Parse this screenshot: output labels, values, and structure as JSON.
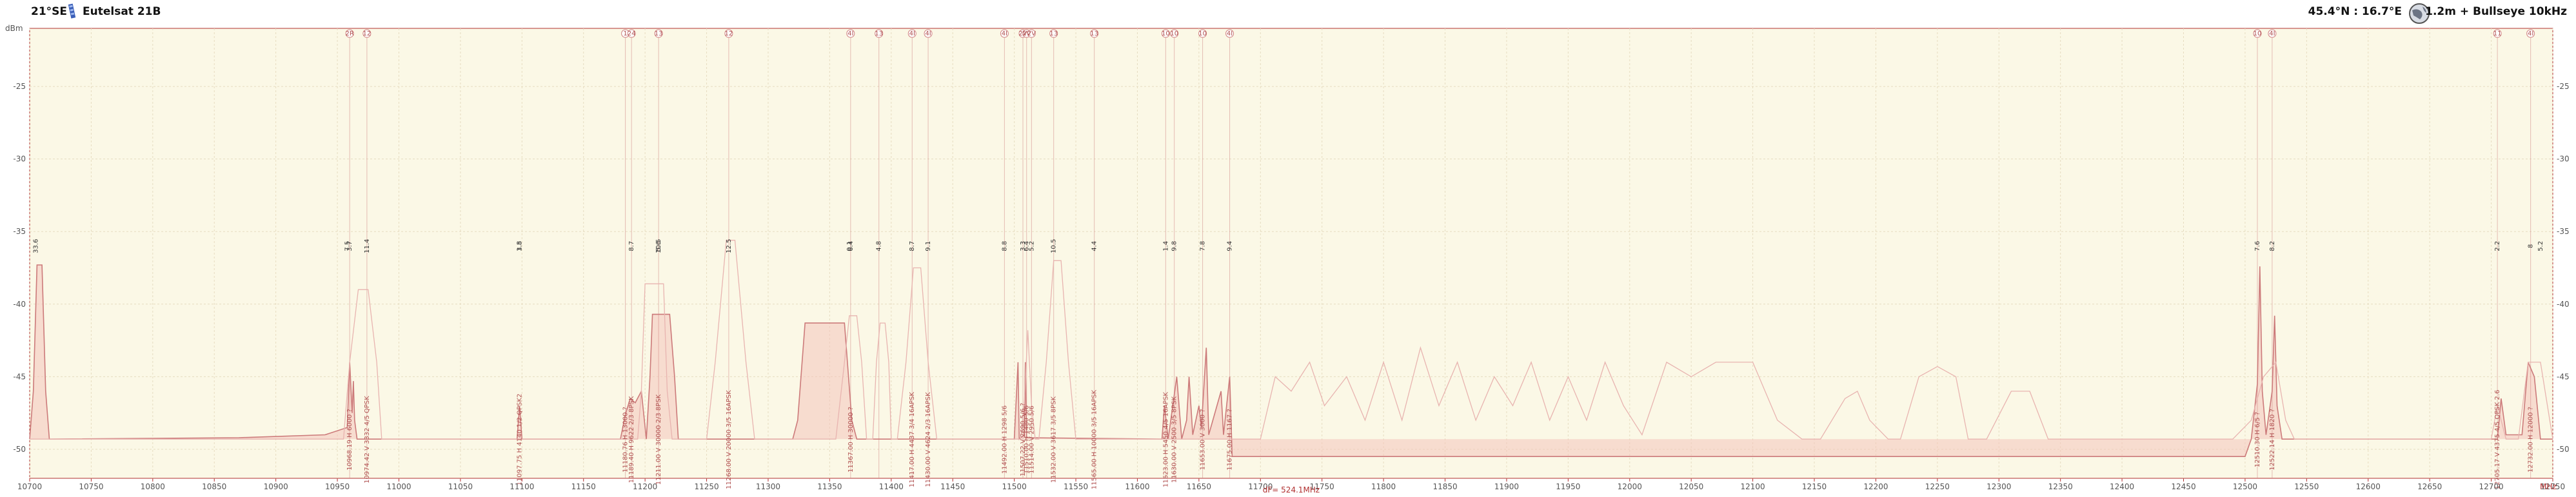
{
  "header": {
    "orbital_position": "21°SE",
    "satellite_name": "Eutelsat 21B",
    "location": "45.4°N : 16.7°E",
    "dish": "1.2m + Bullseye 10kHz"
  },
  "colors": {
    "plot_bg": "#fbf8e6",
    "grid": "#e6dcc0",
    "trace": "#cc7a7a",
    "trace_light": "#e8b4b0",
    "fill": "#f4c4bc",
    "marker": "#d08080",
    "axis": "#b03030"
  },
  "chart_data": {
    "type": "line",
    "title": "",
    "xlabel": "MHz",
    "ylabel": "dBm",
    "xlim": [
      10700,
      12750
    ],
    "ylim": [
      -52,
      -21
    ],
    "x_ticks": [
      10700,
      10750,
      10800,
      10850,
      10900,
      10950,
      11000,
      11050,
      11100,
      11150,
      11200,
      11250,
      11300,
      11350,
      11400,
      11450,
      11500,
      11550,
      11600,
      11650,
      11700,
      11750,
      11800,
      11850,
      11900,
      11950,
      12000,
      12050,
      12100,
      12150,
      12200,
      12250,
      12300,
      12350,
      12400,
      12450,
      12500,
      12550,
      12600,
      12650,
      12700,
      12750
    ],
    "y_ticks": [
      -25,
      -30,
      -35,
      -40,
      -45,
      -50
    ],
    "df_label": "dF= 524.1MHz",
    "baseline": -49.3,
    "series": [
      {
        "name": "H",
        "style": "dark",
        "points": [
          [
            10700,
            -49.3
          ],
          [
            10703,
            -46
          ],
          [
            10706,
            -37.3
          ],
          [
            10710,
            -37.3
          ],
          [
            10713,
            -46
          ],
          [
            10716,
            -49.3
          ],
          [
            10870,
            -49.2
          ],
          [
            10940,
            -49
          ],
          [
            10958,
            -48.5
          ],
          [
            10960,
            -44
          ],
          [
            10962,
            -47.5
          ],
          [
            10963,
            -45.3
          ],
          [
            10964,
            -48
          ],
          [
            10966,
            -49.3
          ],
          [
            11096,
            -49.3
          ],
          [
            11098,
            -47
          ],
          [
            11100,
            -49.3
          ],
          [
            11180,
            -49.3
          ],
          [
            11184,
            -47.6
          ],
          [
            11188,
            -46.5
          ],
          [
            11192,
            -46.8
          ],
          [
            11197,
            -46
          ],
          [
            11201,
            -49.3
          ],
          [
            11204,
            -45
          ],
          [
            11206,
            -40.7
          ],
          [
            11220,
            -40.7
          ],
          [
            11224,
            -45
          ],
          [
            11227,
            -49.3
          ],
          [
            11320,
            -49.3
          ],
          [
            11324,
            -48
          ],
          [
            11330,
            -41.3
          ],
          [
            11362,
            -41.3
          ],
          [
            11368,
            -48
          ],
          [
            11372,
            -49.3
          ],
          [
            11500,
            -49.3
          ],
          [
            11503,
            -44
          ],
          [
            11504,
            -49.3
          ],
          [
            11508,
            -49
          ],
          [
            11509,
            -44
          ],
          [
            11510,
            -49.2
          ],
          [
            11620,
            -49.3
          ],
          [
            11622,
            -47
          ],
          [
            11625,
            -49.3
          ],
          [
            11632,
            -45
          ],
          [
            11636,
            -49.3
          ],
          [
            11640,
            -48
          ],
          [
            11642,
            -45
          ],
          [
            11645,
            -49
          ],
          [
            11650,
            -47
          ],
          [
            11652,
            -48.5
          ],
          [
            11656,
            -43
          ],
          [
            11658,
            -49
          ],
          [
            11668,
            -46
          ],
          [
            11670,
            -49
          ],
          [
            11675,
            -45
          ],
          [
            11677,
            -50.5
          ],
          [
            12500,
            -50.5
          ],
          [
            12505,
            -49.3
          ],
          [
            12510,
            -45.5
          ],
          [
            12512,
            -37.4
          ],
          [
            12514,
            -46
          ],
          [
            12517,
            -49
          ],
          [
            12522,
            -46
          ],
          [
            12524,
            -40.8
          ],
          [
            12526,
            -47
          ],
          [
            12530,
            -49.3
          ],
          [
            12705,
            -49.3
          ],
          [
            12708,
            -46.5
          ],
          [
            12712,
            -49
          ],
          [
            12725,
            -49
          ],
          [
            12730,
            -44
          ],
          [
            12735,
            -45
          ],
          [
            12740,
            -49.3
          ],
          [
            12750,
            -49.3
          ]
        ]
      },
      {
        "name": "V",
        "style": "light",
        "points": [
          [
            10700,
            -49.3
          ],
          [
            10955,
            -49.3
          ],
          [
            10960,
            -44
          ],
          [
            10967,
            -39
          ],
          [
            10975,
            -39
          ],
          [
            10982,
            -44
          ],
          [
            10986,
            -49.3
          ],
          [
            11194,
            -49.3
          ],
          [
            11197,
            -46
          ],
          [
            11200,
            -38.6
          ],
          [
            11215,
            -38.6
          ],
          [
            11218,
            -46
          ],
          [
            11222,
            -49.3
          ],
          [
            11250,
            -49.3
          ],
          [
            11257,
            -44
          ],
          [
            11266,
            -35.6
          ],
          [
            11273,
            -35.6
          ],
          [
            11282,
            -44
          ],
          [
            11289,
            -49.3
          ],
          [
            11355,
            -49.3
          ],
          [
            11362,
            -44
          ],
          [
            11366,
            -40.8
          ],
          [
            11372,
            -40.8
          ],
          [
            11376,
            -44
          ],
          [
            11380,
            -49.3
          ],
          [
            11385,
            -49.3
          ],
          [
            11388,
            -44
          ],
          [
            11391,
            -41.3
          ],
          [
            11395,
            -41.3
          ],
          [
            11398,
            -44
          ],
          [
            11400,
            -49.3
          ],
          [
            11405,
            -49.3
          ],
          [
            11412,
            -44
          ],
          [
            11418,
            -37.5
          ],
          [
            11424,
            -37.5
          ],
          [
            11430,
            -44
          ],
          [
            11437,
            -49.3
          ],
          [
            11505,
            -49.3
          ],
          [
            11508,
            -47
          ],
          [
            11511,
            -41.8
          ],
          [
            11514,
            -47
          ],
          [
            11517,
            -49.3
          ],
          [
            11520,
            -49.3
          ],
          [
            11526,
            -44
          ],
          [
            11532,
            -37
          ],
          [
            11538,
            -37
          ],
          [
            11544,
            -44
          ],
          [
            11550,
            -49.3
          ],
          [
            11700,
            -49.3
          ],
          [
            11712,
            -45
          ],
          [
            11725,
            -46
          ],
          [
            11740,
            -44
          ],
          [
            11752,
            -47
          ],
          [
            11770,
            -45
          ],
          [
            11785,
            -48
          ],
          [
            11800,
            -44
          ],
          [
            11815,
            -48
          ],
          [
            11830,
            -43
          ],
          [
            11845,
            -47
          ],
          [
            11860,
            -44
          ],
          [
            11875,
            -48
          ],
          [
            11890,
            -45
          ],
          [
            11905,
            -47
          ],
          [
            11920,
            -44
          ],
          [
            11935,
            -48
          ],
          [
            11950,
            -45
          ],
          [
            11965,
            -48
          ],
          [
            11980,
            -44
          ],
          [
            11995,
            -47
          ],
          [
            12010,
            -49
          ],
          [
            12030,
            -44
          ],
          [
            12050,
            -45
          ],
          [
            12070,
            -44
          ],
          [
            12090,
            -44
          ],
          [
            12100,
            -44
          ],
          [
            12120,
            -48
          ],
          [
            12140,
            -49.3
          ],
          [
            12155,
            -49.3
          ],
          [
            12175,
            -46.5
          ],
          [
            12185,
            -46
          ],
          [
            12195,
            -48
          ],
          [
            12210,
            -49.3
          ],
          [
            12220,
            -49.3
          ],
          [
            12235,
            -45
          ],
          [
            12250,
            -44.3
          ],
          [
            12265,
            -45
          ],
          [
            12275,
            -49.3
          ],
          [
            12290,
            -49.3
          ],
          [
            12310,
            -46
          ],
          [
            12325,
            -46
          ],
          [
            12340,
            -49.3
          ],
          [
            12490,
            -49.3
          ],
          [
            12505,
            -48
          ],
          [
            12515,
            -45
          ],
          [
            12525,
            -44
          ],
          [
            12533,
            -48
          ],
          [
            12540,
            -49.3
          ],
          [
            12700,
            -49.3
          ],
          [
            12705,
            -47
          ],
          [
            12712,
            -49.3
          ],
          [
            12722,
            -49.3
          ],
          [
            12730,
            -44
          ],
          [
            12740,
            -44
          ],
          [
            12750,
            -49.3
          ]
        ]
      }
    ],
    "transponders": [
      {
        "f": 10705,
        "level": "33.6",
        "num": "",
        "info": ""
      },
      {
        "f": 10958,
        "level": "7.5",
        "num": "",
        "info": ""
      },
      {
        "f": 10960,
        "level": "3.7",
        "num": "2R",
        "info": "10968.19 H 6000 ?"
      },
      {
        "f": 10974,
        "level": "11.4",
        "num": "12",
        "info": "10974.42 V 3332 4/5 QPSK"
      },
      {
        "f": 11098,
        "level": "3.5",
        "num": "",
        "info": "11097.75 H 4140 1/2 QPSK2"
      },
      {
        "f": 11098,
        "level": "1.8",
        "num": "",
        "info": ""
      },
      {
        "f": 11184,
        "level": "",
        "num": "1",
        "info": "11180.76 H 13000 ?"
      },
      {
        "f": 11189,
        "level": "8.7",
        "num": "24",
        "info": "11189.40 H 9622 2/3 8PSK"
      },
      {
        "f": 11211,
        "level": "10.5",
        "num": "13",
        "info": "11211.00 V 30000 2/3 8PSK"
      },
      {
        "f": 11211,
        "level": "5.6",
        "num": "",
        "info": ""
      },
      {
        "f": 11268,
        "level": "12.5",
        "num": "12",
        "info": "11268.00 V 20000 3/5 16APSK"
      },
      {
        "f": 11367,
        "level": "6.4",
        "num": "4I",
        "info": "11367.00 H 30000 ?"
      },
      {
        "f": 11366,
        "level": "0.1",
        "num": "",
        "info": ""
      },
      {
        "f": 11390,
        "level": "4.8",
        "num": "13",
        "info": ""
      },
      {
        "f": 11417,
        "level": "8.7",
        "num": "4I",
        "info": "11417.00 H 4437 3/4 16APSK"
      },
      {
        "f": 11430,
        "level": "9.1",
        "num": "4I",
        "info": "11430.00 V 4624 2/3 16APSK"
      },
      {
        "f": 11492,
        "level": "8.8",
        "num": "4I",
        "info": "11492.00 H 1298 5/6"
      },
      {
        "f": 11507,
        "level": "3.3",
        "num": "2V",
        "info": "11507.22 V 2690 5/6 ?"
      },
      {
        "f": 11510,
        "level": "6.4",
        "num": "2V",
        "info": "11510.00 H 1480 5/6"
      },
      {
        "f": 11514,
        "level": "5.2",
        "num": "2V",
        "info": "11514.00 V 2950 5/6"
      },
      {
        "f": 11532,
        "level": "10.5",
        "num": "13",
        "info": "11532.00 V 3617 3/5 8PSK"
      },
      {
        "f": 11565,
        "level": "4.4",
        "num": "13",
        "info": "11565.00 H 10000 3/5 16APSK"
      },
      {
        "f": 11623,
        "level": "1.4",
        "num": "10",
        "info": "11623.00 H 5450 4/5 16APSK"
      },
      {
        "f": 11630,
        "level": "9.8",
        "num": "10",
        "info": "11630.00 V 2500 3/5 8PSK"
      },
      {
        "f": 11653,
        "level": "7.8",
        "num": "10",
        "info": "11653.00 V 3000 ?"
      },
      {
        "f": 11675,
        "level": "9.4",
        "num": "4I",
        "info": "11675.00 H 1167 ?"
      },
      {
        "f": 12510,
        "level": "7.6",
        "num": "10",
        "info": "12510.30 H 6/5 ?"
      },
      {
        "f": 12522,
        "level": "8.2",
        "num": "4I",
        "info": "12522.14 H 1820 ?"
      },
      {
        "f": 12705,
        "level": "2.2",
        "num": "11",
        "info": "12705.17 V 4375 4/5 QPSK 2.6"
      },
      {
        "f": 12732,
        "level": "8",
        "num": "4I",
        "info": "12732.00 H 12000 ?"
      },
      {
        "f": 12740,
        "level": "5.2",
        "num": "",
        "info": ""
      }
    ]
  }
}
